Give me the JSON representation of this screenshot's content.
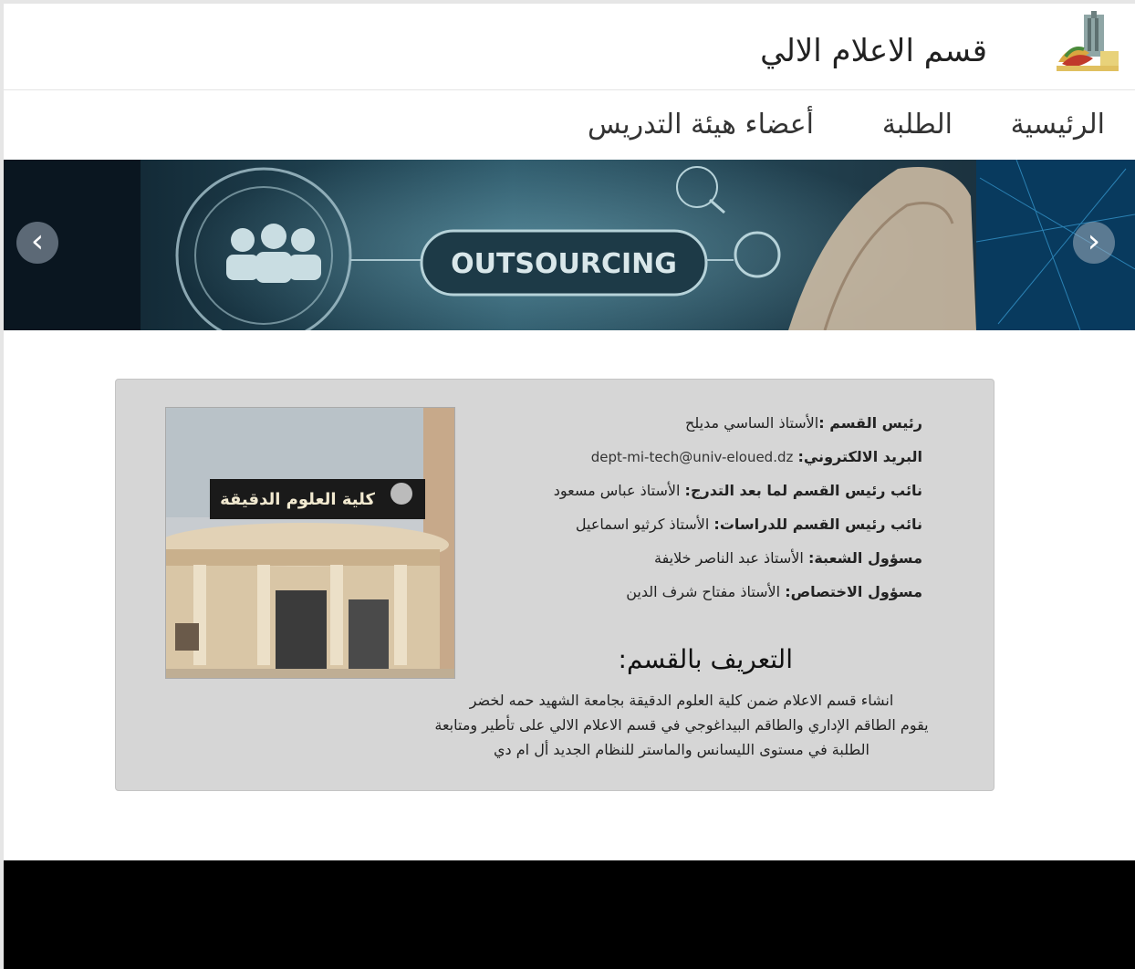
{
  "header": {
    "site_title": "قسم الاعلام الالي"
  },
  "nav": {
    "items": [
      "الرئيسية",
      "الطلبة",
      "أعضاء هيئة التدريس"
    ]
  },
  "carousel": {
    "slide_text": "OUTSOURCING",
    "prev_icon": "‹",
    "next_icon": "›"
  },
  "card": {
    "head_label": "رئيس القسم :",
    "head_value": "الأستاذ الساسي مديلح",
    "email_label": "البريد الالكتروني:",
    "email_value": "dept-mi-tech@univ-eloued.dz",
    "vice_pg_label": "نائب رئيس القسم لما بعد التدرج:",
    "vice_pg_value": "الأستاذ عباس مسعود",
    "vice_studies_label": "نائب رئيس القسم للدراسات:",
    "vice_studies_value": "الأستاذ كرثيو اسماعيل",
    "branch_label": "مسؤول الشعبة:",
    "branch_value": "الأستاذ عبد الناصر خلايفة",
    "spec_label": "مسؤول الاختصاص:",
    "spec_value": "الأستاذ مفتاح شرف الدين",
    "photo_sign": "كلية العلوم الدقيقة",
    "about_title": "التعريف بالقسم:",
    "about_lines": [
      "انشاء  قسم الاعلام ضمن كلية العلوم الدقيقة بجامعة الشهيد حمه لخضر",
      "يقوم الطاقم الإداري والطاقم البيداغوجي في قسم الاعلام الالي على تأطير ومتابعة",
      "الطلبة في مستوى الليسانس والماستر للنظام الجديد أل ام دي"
    ]
  },
  "colors": {
    "card_bg": "#d6d6d6",
    "footer_bg": "#000000",
    "carousel_bg": "#0a1a2a"
  },
  "icons": {
    "logo": "university-logo-icon",
    "prev": "chevron-left-icon",
    "next": "chevron-right-icon"
  }
}
